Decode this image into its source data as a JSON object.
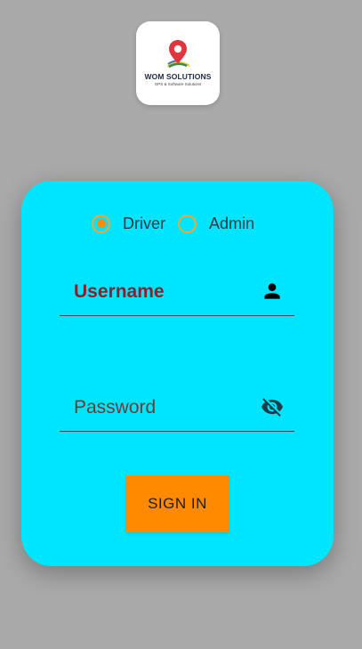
{
  "logo": {
    "title": "WOM SOLUTIONS",
    "subtitle": "GPS & Software Solutions",
    "icon": "map-pin-icon"
  },
  "role_selector": {
    "options": [
      {
        "label": "Driver",
        "selected": true
      },
      {
        "label": "Admin",
        "selected": false
      }
    ]
  },
  "form": {
    "username": {
      "placeholder": "Username",
      "value": "",
      "icon": "person-icon"
    },
    "password": {
      "placeholder": "Password",
      "value": "",
      "icon": "visibility-off-icon"
    },
    "submit_label": "SIGN IN"
  },
  "colors": {
    "background": "#a9a9a9",
    "card": "#00e5ff",
    "accent": "#ff8a00",
    "username_text": "#8b1f2b"
  }
}
